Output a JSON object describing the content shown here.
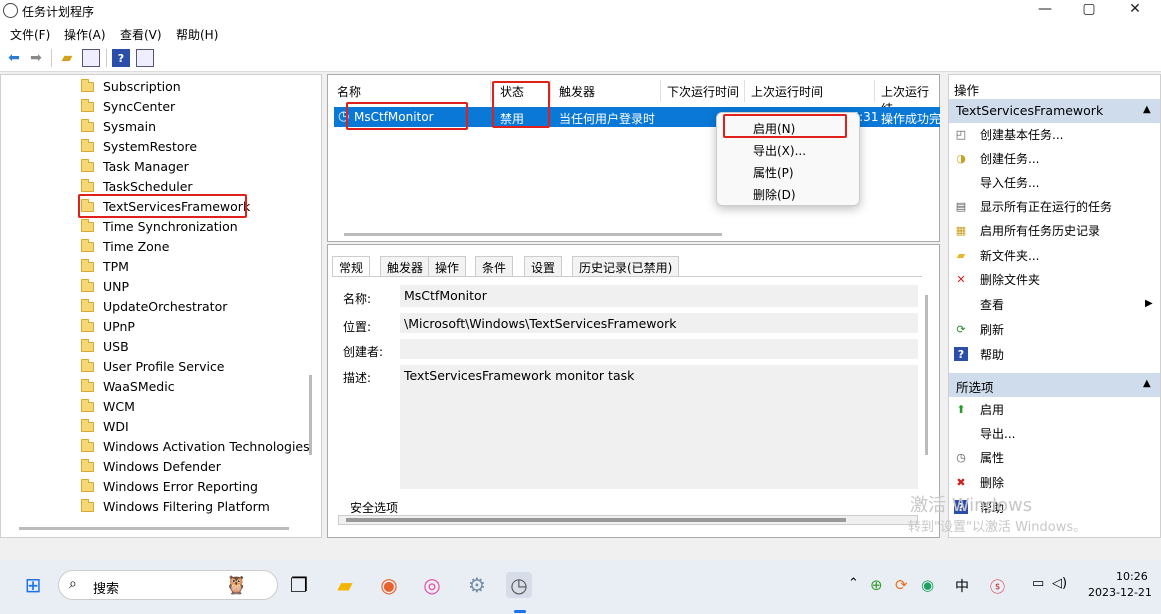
{
  "window": {
    "title": "任务计划程序"
  },
  "menu": [
    "文件(F)",
    "操作(A)",
    "查看(V)",
    "帮助(H)"
  ],
  "tree_items": [
    "Subscription",
    "SyncCenter",
    "Sysmain",
    "SystemRestore",
    "Task Manager",
    "TaskScheduler",
    "TextServicesFramework",
    "Time Synchronization",
    "Time Zone",
    "TPM",
    "UNP",
    "UpdateOrchestrator",
    "UPnP",
    "USB",
    "User Profile Service",
    "WaaSMedic",
    "WCM",
    "WDI",
    "Windows Activation Technologies",
    "Windows Defender",
    "Windows Error Reporting",
    "Windows Filtering Platform"
  ],
  "task_columns": [
    "名称",
    "状态",
    "触发器",
    "下次运行时间",
    "上次运行时间",
    "上次运行结"
  ],
  "task_row": {
    "name": "MsCtfMonitor",
    "status": "禁用",
    "trigger": "当任何用户登录时",
    "last_run": "2023-12-14 10:35:31",
    "last_result": "操作成功完"
  },
  "context_menu": [
    "启用(N)",
    "导出(X)...",
    "属性(P)",
    "删除(D)"
  ],
  "detail_tabs": [
    "常规",
    "触发器",
    "操作",
    "条件",
    "设置",
    "历史记录(已禁用)"
  ],
  "details": {
    "name_label": "名称:",
    "name_value": "MsCtfMonitor",
    "location_label": "位置:",
    "location_value": "\\Microsoft\\Windows\\TextServicesFramework",
    "author_label": "创建者:",
    "desc_label": "描述:",
    "desc_value": "TextServicesFramework monitor task",
    "security_label": "安全选项"
  },
  "actions": {
    "header1": "操作",
    "section1": "TextServicesFramework",
    "items1": [
      "创建基本任务...",
      "创建任务...",
      "导入任务...",
      "显示所有正在运行的任务",
      "启用所有任务历史记录",
      "新文件夹...",
      "删除文件夹",
      "查看",
      "刷新",
      "帮助"
    ],
    "section2": "所选项",
    "items2": [
      "启用",
      "导出...",
      "属性",
      "删除",
      "帮助"
    ]
  },
  "watermark": {
    "line1": "激活 Windows",
    "line2": "转到\"设置\"以激活 Windows。"
  },
  "taskbar": {
    "search_placeholder": "搜索",
    "time": "10:26",
    "date": "2023-12-21",
    "ime": "中"
  },
  "colors": {
    "selection": "#0a78d7",
    "highlight_box": "#e0201a",
    "section_header": "#cfdcec"
  }
}
